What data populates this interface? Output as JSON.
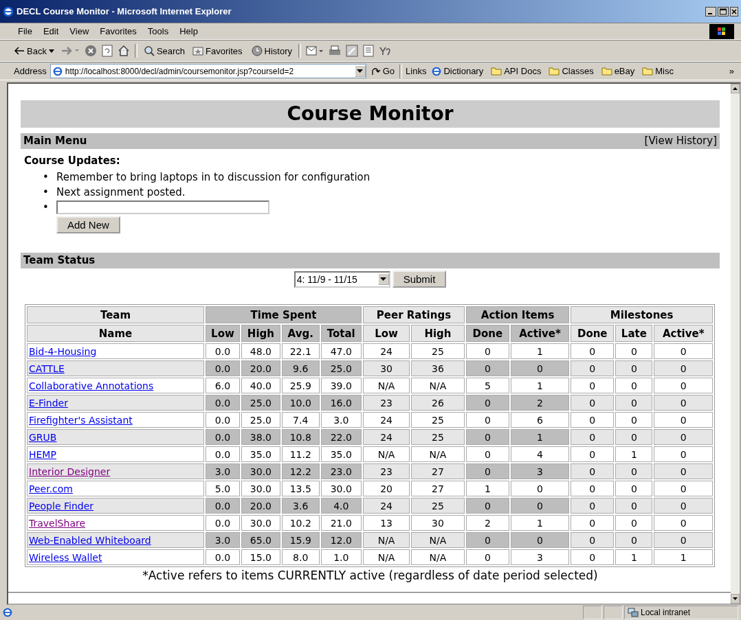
{
  "window": {
    "title": "DECL Course Monitor - Microsoft Internet Explorer"
  },
  "menu": [
    "File",
    "Edit",
    "View",
    "Favorites",
    "Tools",
    "Help"
  ],
  "toolbar": {
    "back": "Back",
    "search": "Search",
    "favorites": "Favorites",
    "history": "History"
  },
  "address": {
    "label": "Address",
    "url": "http://localhost:8000/decl/admin/coursemonitor.jsp?courseId=2",
    "go": "Go"
  },
  "links": {
    "label": "Links",
    "items": [
      {
        "kind": "page",
        "label": "Dictionary"
      },
      {
        "kind": "folder",
        "label": "API Docs"
      },
      {
        "kind": "folder",
        "label": "Classes"
      },
      {
        "kind": "folder",
        "label": "eBay"
      },
      {
        "kind": "folder",
        "label": "Misc"
      }
    ],
    "more": "»"
  },
  "page": {
    "title": "Course Monitor",
    "main_menu": "Main Menu",
    "view_history": "[View History]",
    "updates_heading": "Course Updates:",
    "updates": [
      {
        "bullet": "•",
        "text": "Remember to bring laptops in to discussion for configuration"
      },
      {
        "bullet": "•",
        "text": "Next assignment posted."
      }
    ],
    "new_update": {
      "bullet": "•"
    },
    "add_button": "Add New",
    "team_status": "Team Status",
    "week": "4: 11/9 - 11/15",
    "submit": "Submit",
    "table": {
      "groups": [
        {
          "label": "Team",
          "columns": [
            "Name"
          ]
        },
        {
          "label": "Time Spent",
          "columns": [
            "Low",
            "High",
            "Avg.",
            "Total"
          ]
        },
        {
          "label": "Peer Ratings",
          "columns": [
            "Low",
            "High"
          ]
        },
        {
          "label": "Action Items",
          "columns": [
            "Done",
            "Active*"
          ]
        },
        {
          "label": "Milestones",
          "columns": [
            "Done",
            "Late",
            "Active*"
          ]
        }
      ],
      "rows": [
        {
          "visited": false,
          "cells": [
            "Bid-4-Housing",
            "0.0",
            "48.0",
            "22.1",
            "47.0",
            "24",
            "25",
            "0",
            "1",
            "0",
            "0",
            "0"
          ]
        },
        {
          "visited": false,
          "cells": [
            "CATTLE",
            "0.0",
            "20.0",
            "9.6",
            "25.0",
            "30",
            "36",
            "0",
            "0",
            "0",
            "0",
            "0"
          ]
        },
        {
          "visited": false,
          "cells": [
            "Collaborative Annotations",
            "6.0",
            "40.0",
            "25.9",
            "39.0",
            "N/A",
            "N/A",
            "5",
            "1",
            "0",
            "0",
            "0"
          ]
        },
        {
          "visited": false,
          "cells": [
            "E-Finder",
            "0.0",
            "25.0",
            "10.0",
            "16.0",
            "23",
            "26",
            "0",
            "2",
            "0",
            "0",
            "0"
          ]
        },
        {
          "visited": false,
          "cells": [
            "Firefighter's Assistant",
            "0.0",
            "25.0",
            "7.4",
            "3.0",
            "24",
            "25",
            "0",
            "6",
            "0",
            "0",
            "0"
          ]
        },
        {
          "visited": false,
          "cells": [
            "GRUB",
            "0.0",
            "38.0",
            "10.8",
            "22.0",
            "24",
            "25",
            "0",
            "1",
            "0",
            "0",
            "0"
          ]
        },
        {
          "visited": false,
          "cells": [
            "HEMP",
            "0.0",
            "35.0",
            "11.2",
            "35.0",
            "N/A",
            "N/A",
            "0",
            "4",
            "0",
            "1",
            "0"
          ]
        },
        {
          "visited": true,
          "cells": [
            "Interior Designer",
            "3.0",
            "30.0",
            "12.2",
            "23.0",
            "23",
            "27",
            "0",
            "3",
            "0",
            "0",
            "0"
          ]
        },
        {
          "visited": false,
          "cells": [
            "Peer.com",
            "5.0",
            "30.0",
            "13.5",
            "30.0",
            "20",
            "27",
            "1",
            "0",
            "0",
            "0",
            "0"
          ]
        },
        {
          "visited": false,
          "cells": [
            "People Finder",
            "0.0",
            "20.0",
            "3.6",
            "4.0",
            "24",
            "25",
            "0",
            "0",
            "0",
            "0",
            "0"
          ]
        },
        {
          "visited": true,
          "cells": [
            "TravelShare",
            "0.0",
            "30.0",
            "10.2",
            "21.0",
            "13",
            "30",
            "2",
            "1",
            "0",
            "0",
            "0"
          ]
        },
        {
          "visited": false,
          "cells": [
            "Web-Enabled Whiteboard",
            "3.0",
            "65.0",
            "15.9",
            "12.0",
            "N/A",
            "N/A",
            "0",
            "0",
            "0",
            "0",
            "0"
          ]
        },
        {
          "visited": false,
          "cells": [
            "Wireless Wallet",
            "0.0",
            "15.0",
            "8.0",
            "1.0",
            "N/A",
            "N/A",
            "0",
            "3",
            "0",
            "1",
            "1"
          ]
        }
      ]
    },
    "footnote": "*Active refers to items CURRENTLY active (regardless of date period selected)"
  },
  "status_bar": {
    "zone": "Local intranet"
  }
}
